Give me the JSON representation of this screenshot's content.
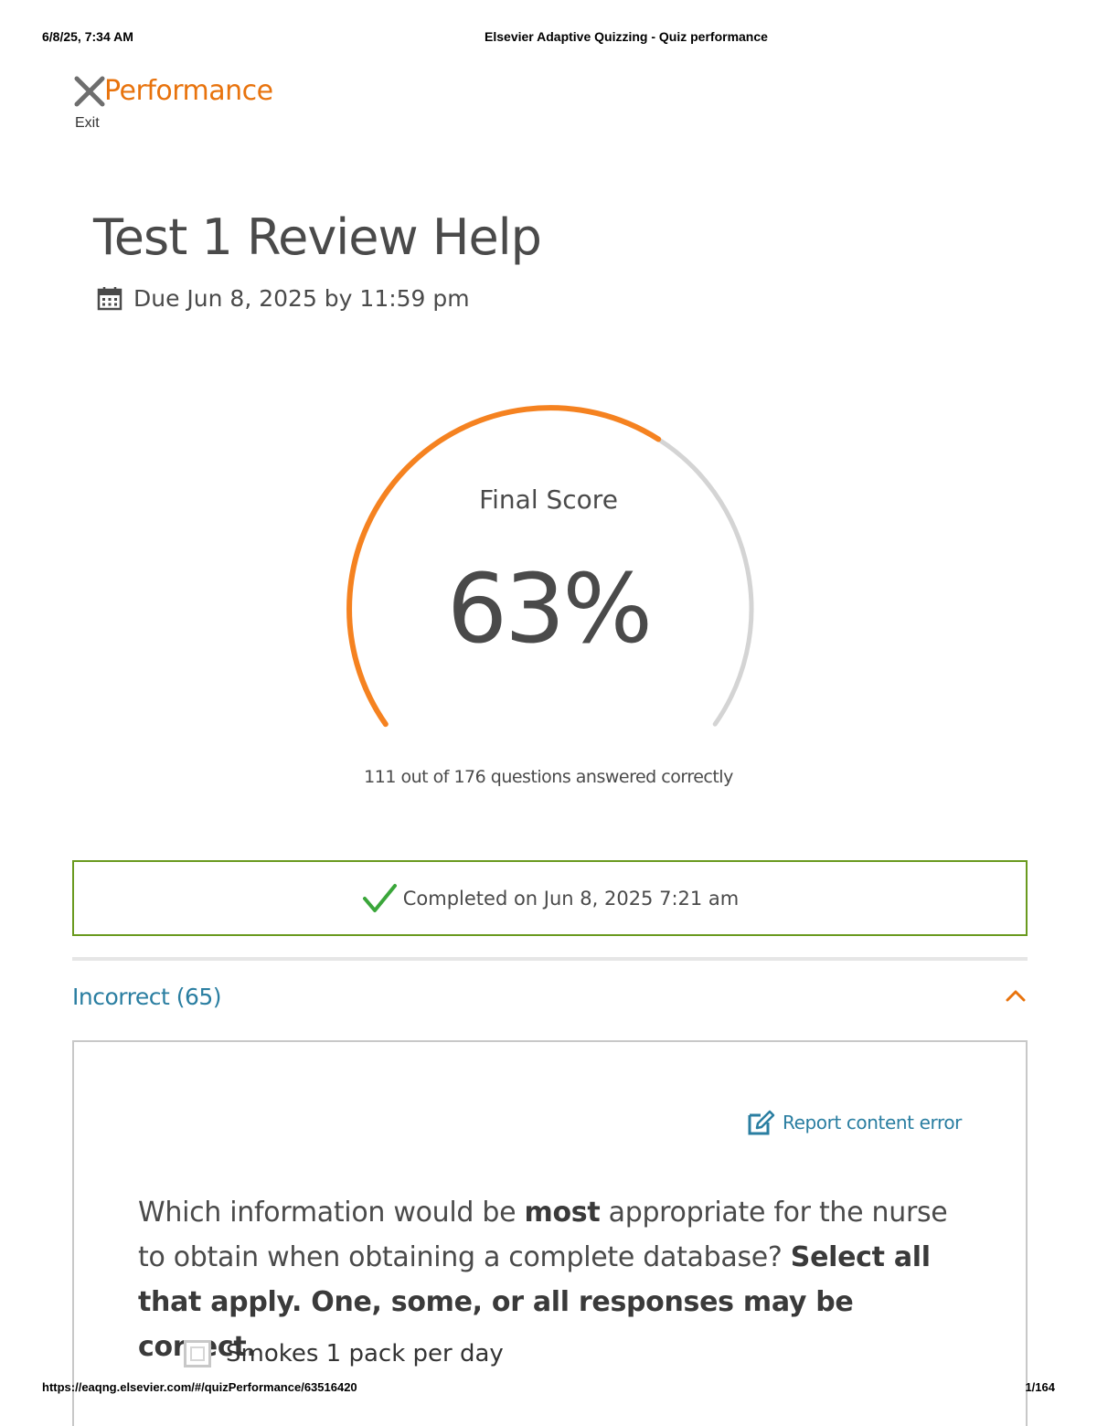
{
  "print_header": {
    "datetime": "6/8/25, 7:34 AM",
    "title": "Elsevier Adaptive Quizzing - Quiz performance"
  },
  "print_footer": {
    "url": "https://eaqng.elsevier.com/#/quizPerformance/63516420",
    "page": "1/164"
  },
  "nav": {
    "exit_label": "Exit",
    "title": "Performance",
    "accent_color": "#e8730d"
  },
  "quiz": {
    "title": "Test 1 Review Help",
    "due": "Due Jun 8, 2025 by 11:59 pm"
  },
  "score": {
    "label": "Final Score",
    "percent_text": "63%",
    "percent": 63,
    "summary": "111 out of 176 questions answered correctly",
    "correct": 111,
    "total": 176,
    "fill_color": "#f58220",
    "track_color": "#d4d4d4"
  },
  "status": {
    "completed": "Completed on Jun 8, 2025 7:21 am",
    "border_color": "#6a9a1f",
    "check_color": "#3aa63a"
  },
  "section": {
    "title": "Incorrect (65)",
    "expanded": true,
    "title_color": "#2a7ea1"
  },
  "question": {
    "report_label": "Report content error",
    "text_part1": "Which information would be ",
    "text_bold1": "most",
    "text_part2": " appropriate for the nurse to obtain when obtaining a complete database? ",
    "text_bold2": "Select all that apply. One, some, or all responses may be correct.",
    "options": [
      {
        "label": "Smokes 1 pack per day",
        "checked": false
      }
    ]
  }
}
